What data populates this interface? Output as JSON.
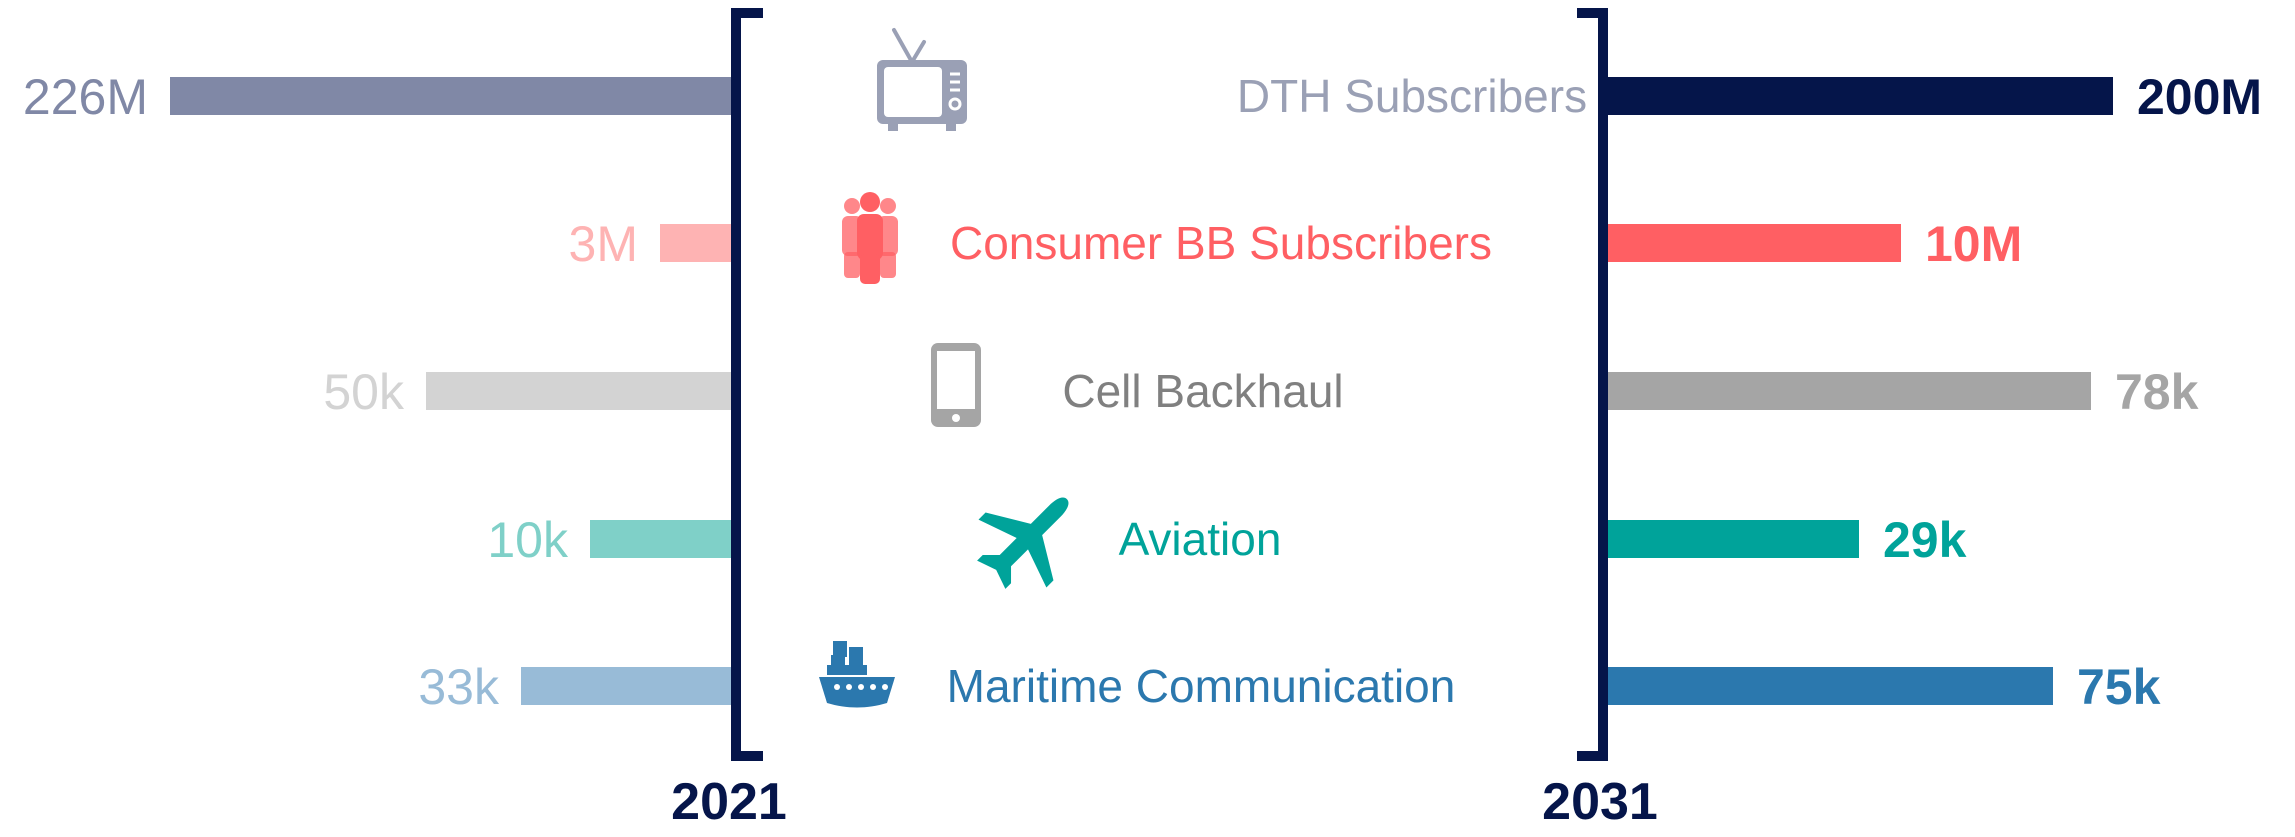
{
  "chart_data": {
    "type": "bar",
    "layout": "butterfly",
    "grid": false,
    "legend": "none",
    "categories": [
      "DTH Subscribers",
      "Consumer BB Subscribers",
      "Cell Backhaul",
      "Aviation",
      "Maritime Communication"
    ],
    "icons": [
      "tv-icon",
      "people-icon",
      "phone-icon",
      "airplane-icon",
      "ship-icon"
    ],
    "series": [
      {
        "name": "2021",
        "side": "left",
        "values": [
          226000000,
          3000000,
          50000,
          10000,
          33000
        ],
        "labels": [
          "226M",
          "3M",
          "50k",
          "10k",
          "33k"
        ],
        "colors": [
          "#8088a6",
          "#feb3b3",
          "#d3d3d3",
          "#7fd0c8",
          "#98bbd7"
        ]
      },
      {
        "name": "2031",
        "side": "right",
        "values": [
          200000000,
          10000000,
          78000,
          29000,
          75000
        ],
        "labels": [
          "200M",
          "10M",
          "78k",
          "29k",
          "75k"
        ],
        "colors": [
          "#05154a",
          "#ff5f63",
          "#a5a5a5",
          "#00a39a",
          "#2b78ae"
        ]
      }
    ],
    "label_colors": [
      "#9aa0b5",
      "#ff5f63",
      "#808080",
      "#00a39a",
      "#2b78ae"
    ],
    "bracket_color": "#05154a"
  }
}
